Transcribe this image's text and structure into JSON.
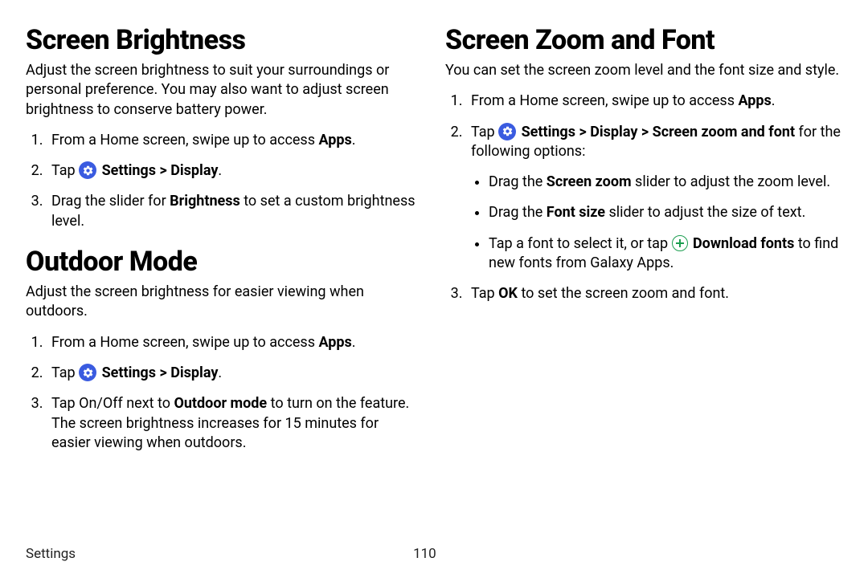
{
  "left": {
    "section1": {
      "title": "Screen Brightness",
      "intro": "Adjust the screen brightness to suit your surroundings or personal preference. You may also want to adjust screen brightness to conserve battery power.",
      "step1_a": "From a Home screen, swipe up to access ",
      "step1_apps": "Apps",
      "step1_b": ".",
      "step2_tap": "Tap ",
      "step2_settings": "Settings",
      "step2_sep": " > ",
      "step2_display": "Display",
      "step2_end": ".",
      "step3_a": "Drag the slider for ",
      "step3_brightness": "Brightness",
      "step3_b": " to set a custom brightness level."
    },
    "section2": {
      "title": "Outdoor Mode",
      "intro": "Adjust the screen brightness for easier viewing when outdoors.",
      "step1_a": "From a Home screen, swipe up to access ",
      "step1_apps": "Apps",
      "step1_b": ".",
      "step2_tap": "Tap ",
      "step2_settings": "Settings",
      "step2_sep": " > ",
      "step2_display": "Display",
      "step2_end": ".",
      "step3_a": "Tap On/Off next to ",
      "step3_outdoor": "Outdoor mode",
      "step3_b": " to turn on the feature. The screen brightness increases for 15 minutes for easier viewing when outdoors."
    }
  },
  "right": {
    "section1": {
      "title": "Screen Zoom and Font",
      "intro": "You can set the screen zoom level and the font size and style.",
      "step1_a": "From a Home screen, swipe up to access ",
      "step1_apps": "Apps",
      "step1_b": ".",
      "step2_tap": "Tap ",
      "step2_settings": "Settings",
      "step2_sep1": " > ",
      "step2_display": "Display",
      "step2_sep2": " > ",
      "step2_zoomfont": "Screen zoom and font",
      "step2_tail": " for the following options:",
      "bullet1_a": "Drag the ",
      "bullet1_b": "Screen zoom",
      "bullet1_c": " slider to adjust the zoom level.",
      "bullet2_a": "Drag the ",
      "bullet2_b": "Font size",
      "bullet2_c": " slider to adjust the size of text.",
      "bullet3_a": "Tap a font to select it, or tap ",
      "bullet3_dl": "Download fonts",
      "bullet3_b": " to find new fonts from Galaxy Apps.",
      "step3_a": "Tap ",
      "step3_ok": "OK",
      "step3_b": " to set the screen zoom and font."
    }
  },
  "footer": {
    "section": "Settings",
    "page": "110"
  }
}
